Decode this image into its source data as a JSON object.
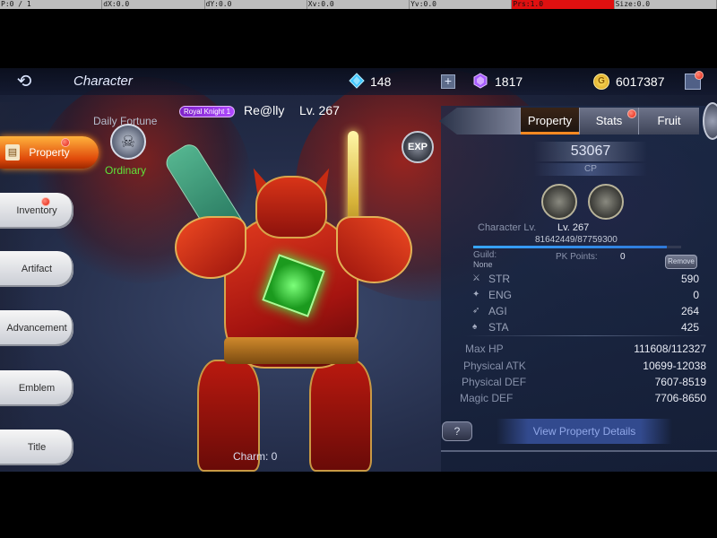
{
  "devbar": {
    "cells": [
      "P:0 / 1",
      "dX:0.0",
      "dY:0.0",
      "Xv:0.0",
      "Yv:0.0",
      "Prs:1.0",
      "Size:0.0"
    ]
  },
  "topbar": {
    "title": "Character",
    "diamonds": "148",
    "crystals": "1817",
    "gold": "6017387",
    "plus": "+",
    "back_glyph": "⟲"
  },
  "sidebar": {
    "items": [
      {
        "label": "Property",
        "active": true
      },
      {
        "label": "Inventory"
      },
      {
        "label": "Artifact"
      },
      {
        "label": "Advancement"
      },
      {
        "label": "Emblem"
      },
      {
        "label": "Title"
      }
    ]
  },
  "character": {
    "daily_fortune": "Daily Fortune",
    "fortune_rank": "Ordinary",
    "title_badge": "Royal Knight 1",
    "name": "Re@lly",
    "level": "Lv. 267",
    "exp_button": "EXP",
    "charm": "Charm:  0"
  },
  "panel": {
    "tabs": [
      "Property",
      "Stats",
      "Fruit"
    ],
    "cp": "53067",
    "cp_label": "CP",
    "character_lv_label": "Character Lv.",
    "character_lv": "Lv. 267",
    "exp": "81642449/87759300",
    "exp_fraction": 0.93,
    "guild_label": "Guild:",
    "guild_value": "None",
    "pk_label": "PK Points:",
    "pk_value": "0",
    "remove_label": "Remove",
    "attributes": [
      {
        "name": "STR",
        "value": "590"
      },
      {
        "name": "ENG",
        "value": "0"
      },
      {
        "name": "AGI",
        "value": "264"
      },
      {
        "name": "STA",
        "value": "425"
      }
    ],
    "battle_stats": [
      {
        "name": "Max HP",
        "value": "111608/112327"
      },
      {
        "name": "Physical ATK",
        "value": "10699-12038"
      },
      {
        "name": "Physical DEF",
        "value": "7607-8519"
      },
      {
        "name": "Magic DEF",
        "value": "7706-8650"
      }
    ],
    "help": "?",
    "details": "View Property Details"
  },
  "colors": {
    "accent": "#ff8a22",
    "panel": "#1c2a48",
    "rank_green": "#5ee43a",
    "devbar_highlight": "#e01010"
  }
}
